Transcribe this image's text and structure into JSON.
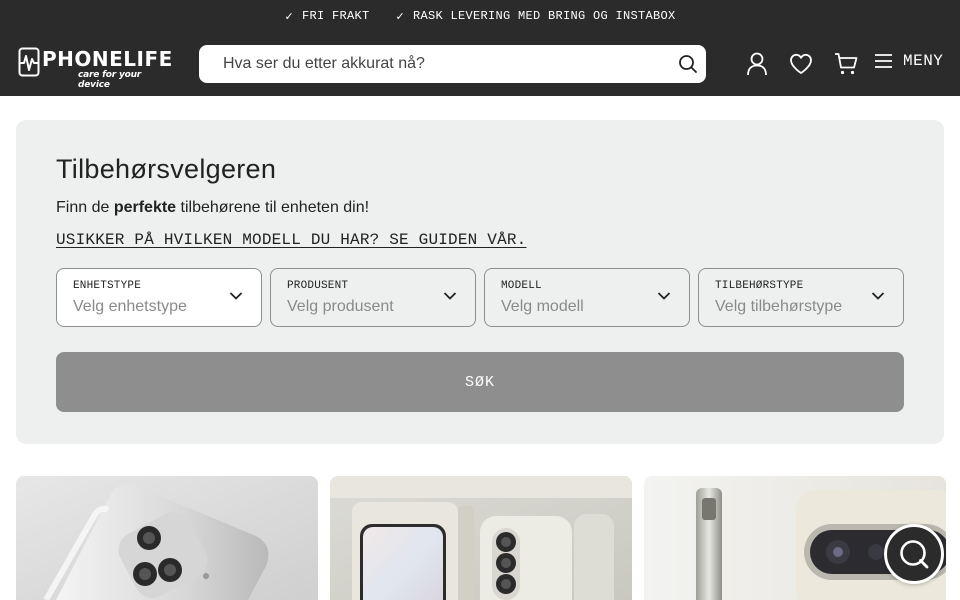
{
  "topbar": {
    "usps": [
      {
        "icon": "check-icon",
        "check": "✓",
        "text": "FRI FRAKT"
      },
      {
        "icon": "check-icon",
        "check": "✓",
        "text": "RASK LEVERING MED BRING OG INSTABOX"
      }
    ]
  },
  "header": {
    "logo_text": "PHONELIFE",
    "logo_tagline": "care for your device",
    "search_placeholder": "Hva ser du etter akkurat nå?",
    "icons": [
      "user-icon",
      "heart-icon",
      "cart-icon",
      "hamburger-icon"
    ],
    "menu_label": "MENY"
  },
  "selector": {
    "title": "Tilbehørsvelgeren",
    "subtitle_pre": "Finn de ",
    "subtitle_bold": "perfekte",
    "subtitle_post": " tilbehørene til enheten din!",
    "guide_link": "USIKKER PÅ HVILKEN MODELL DU HAR? SE GUIDEN VÅR.",
    "dropdowns": [
      {
        "label": "ENHETSTYPE",
        "placeholder": "Velg enhetstype",
        "enabled": true
      },
      {
        "label": "PRODUSENT",
        "placeholder": "Velg produsent",
        "enabled": false
      },
      {
        "label": "MODELL",
        "placeholder": "Velg modell",
        "enabled": false
      },
      {
        "label": "TILBEHØRSTYPE",
        "placeholder": "Velg tilbehørstype",
        "enabled": false
      }
    ],
    "search_button": "SØK"
  },
  "colors": {
    "header_bg": "#2b2b2b",
    "panel_bg": "#eef0ef",
    "button_disabled": "#8e8e8e"
  }
}
